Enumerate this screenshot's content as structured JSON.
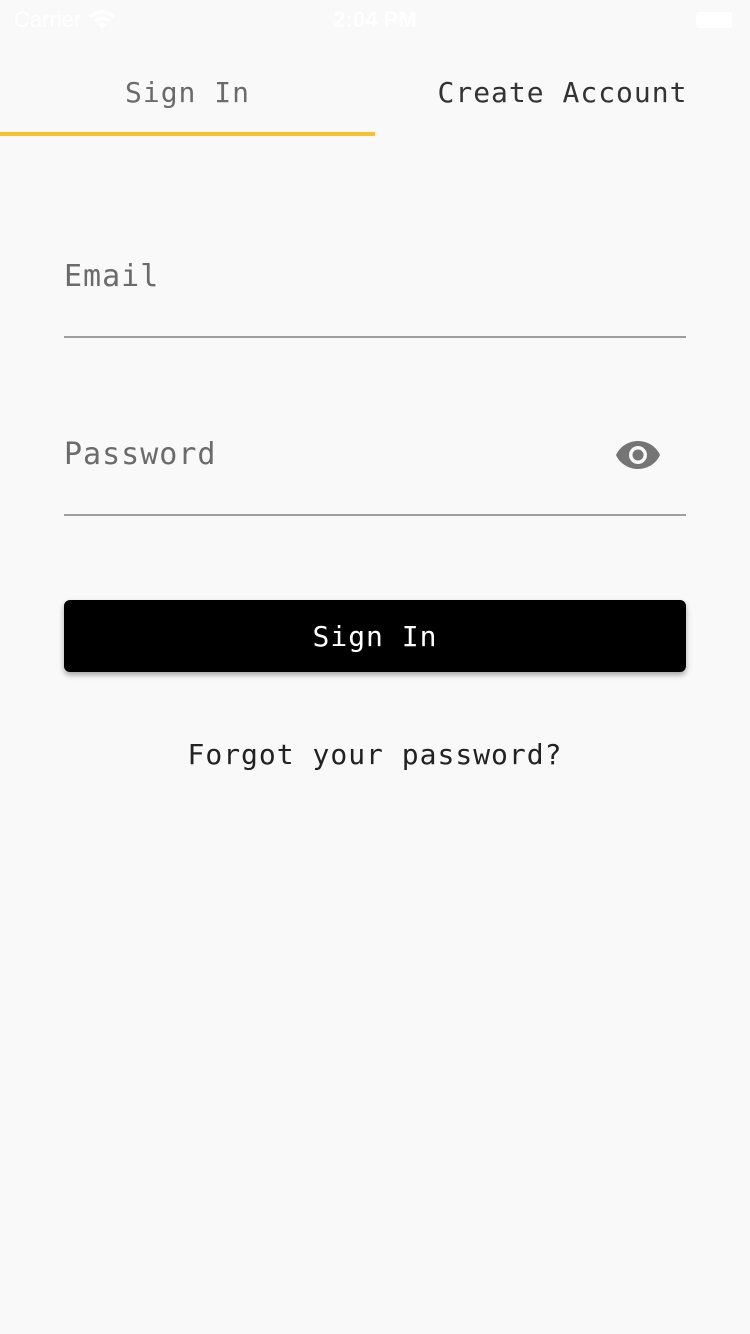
{
  "status_bar": {
    "carrier": "Carrier",
    "time": "2:04 PM"
  },
  "tabs": [
    {
      "label": "Sign In",
      "active": true
    },
    {
      "label": "Create Account",
      "active": false
    }
  ],
  "form": {
    "email_placeholder": "Email",
    "email_value": "",
    "password_placeholder": "Password",
    "password_value": "",
    "submit_label": "Sign In",
    "forgot_label": "Forgot your password?"
  },
  "colors": {
    "accent": "#fbc02d",
    "button": "#000000",
    "background": "#f9f9f9"
  },
  "icons": {
    "wifi": "wifi-icon",
    "battery": "battery-icon",
    "password_toggle": "eye-icon"
  }
}
